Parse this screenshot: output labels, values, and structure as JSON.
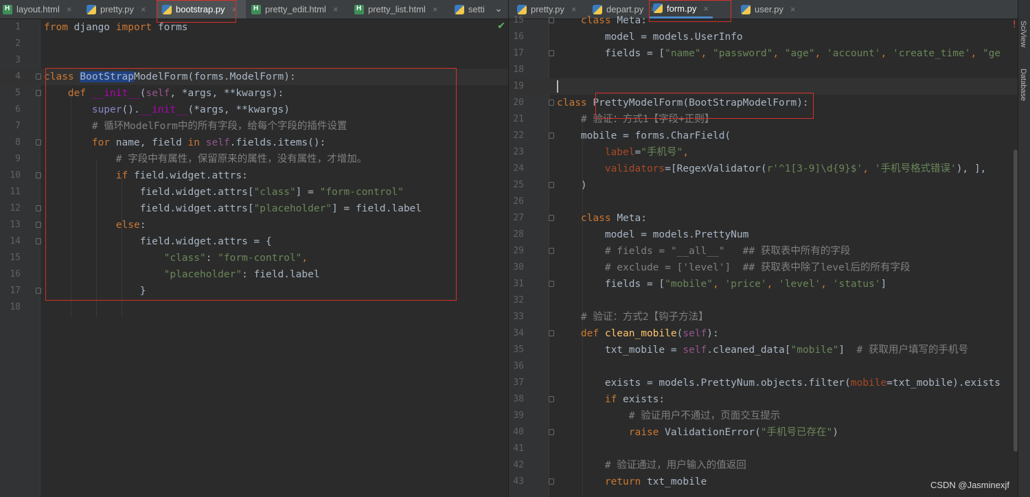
{
  "left_tabs": [
    {
      "label": "layout.html",
      "type": "html"
    },
    {
      "label": "pretty.py",
      "type": "py"
    },
    {
      "label": "bootstrap.py",
      "type": "py",
      "active": true
    },
    {
      "label": "pretty_edit.html",
      "type": "html"
    },
    {
      "label": "pretty_list.html",
      "type": "html"
    },
    {
      "label": "setti",
      "type": "py"
    }
  ],
  "right_tabs": [
    {
      "label": "pretty.py",
      "type": "py"
    },
    {
      "label": "depart.py",
      "type": "py"
    },
    {
      "label": "form.py",
      "type": "py",
      "active": true
    },
    {
      "label": "user.py",
      "type": "py"
    }
  ],
  "left_code": {
    "l1": {
      "kw1": "from",
      "mod": " django ",
      "kw2": "import",
      "name": " forms"
    },
    "l4": {
      "kw": "class ",
      "hl": "BootStrap",
      "cls_rest": "ModelForm",
      "rest": "(forms.ModelForm):"
    },
    "l5": {
      "kw": "def ",
      "fn": "__init__",
      "p1": "(",
      "self": "self",
      "rest": ", *args, **kwargs):"
    },
    "l6": {
      "sup": "super",
      "p": "().",
      "dunder": "__init__",
      "rest": "(*args, **kwargs)"
    },
    "l7": {
      "cmt": "# 循环ModelForm中的所有字段，给每个字段的插件设置"
    },
    "l8": {
      "kw1": "for",
      "mid": " name, field ",
      "kw2": "in",
      "sp": " ",
      "self": "self",
      "rest": ".fields.items():"
    },
    "l9": {
      "cmt": "# 字段中有属性，保留原来的属性，没有属性，才增加。"
    },
    "l10": {
      "kw": "if",
      "rest": " field.widget.attrs:"
    },
    "l11": {
      "a": "field.widget.attrs[",
      "s1": "\"class\"",
      "b": "] = ",
      "s2": "\"form-control\""
    },
    "l12": {
      "a": "field.widget.attrs[",
      "s1": "\"placeholder\"",
      "b": "] = field.label"
    },
    "l13": {
      "kw": "else",
      "rest": ":"
    },
    "l14": {
      "text": "field.widget.attrs = {"
    },
    "l15": {
      "s1": "\"class\"",
      "b": ": ",
      "s2": "\"form-control\"",
      "c": ","
    },
    "l16": {
      "s1": "\"placeholder\"",
      "b": ": field.label"
    },
    "l17": {
      "text": "}"
    }
  },
  "right_code": {
    "l15": {
      "kw": "class ",
      "rest": "Meta:"
    },
    "l16": {
      "text": "model = models.UserInfo"
    },
    "l17": {
      "a": "fields = [",
      "s1": "\"name\"",
      "c1": ", ",
      "s2": "\"password\"",
      "c2": ", ",
      "s3": "\"age\"",
      "c3": ", ",
      "s4": "'account'",
      "c4": ", ",
      "s5": "'create_time'",
      "c5": ", ",
      "s6": "\"ge"
    },
    "l20": {
      "kw": "class ",
      "rest": "PrettyModelForm(BootStrapModelForm):"
    },
    "l21": {
      "cmt": "# 验证：方式1【字段+正则】"
    },
    "l22": {
      "text": "mobile = forms.CharField("
    },
    "l23": {
      "param": "label",
      "eq": "=",
      "s": "\"手机号\"",
      "c": ","
    },
    "l24": {
      "param": "validators",
      "eq": "=[RegexValidator(",
      "s1": "r'^1[3-9]\\d{9}$'",
      "c": ", ",
      "s2": "'手机号格式错误'",
      "end": "), ],"
    },
    "l25": {
      "text": ")"
    },
    "l27": {
      "kw": "class ",
      "rest": "Meta:"
    },
    "l28": {
      "text": "model = models.PrettyNum"
    },
    "l29": {
      "cmt": "# fields = \"__all__\"   ## 获取表中所有的字段"
    },
    "l30": {
      "cmt": "# exclude = ['level']  ## 获取表中除了level后的所有字段"
    },
    "l31": {
      "a": "fields = [",
      "s1": "\"mobile\"",
      "c1": ", ",
      "s2": "'price'",
      "c2": ", ",
      "s3": "'level'",
      "c3": ", ",
      "s4": "'status'",
      "end": "]"
    },
    "l33": {
      "cmt": "# 验证：方式2【钩子方法】"
    },
    "l34": {
      "kw": "def ",
      "fn": "clean_mobile",
      "p": "(",
      "self": "self",
      "end": "):"
    },
    "l35": {
      "a": "txt_mobile = ",
      "self": "self",
      "b": ".cleaned_data[",
      "s": "\"mobile\"",
      "c": "]  ",
      "cmt": "# 获取用户填写的手机号"
    },
    "l37": {
      "a": "exists = models.PrettyNum.objects.filter(",
      "param": "mobile",
      "b": "=txt_mobile).exists"
    },
    "l38": {
      "kw": "if",
      "rest": " exists:"
    },
    "l39": {
      "cmt": "# 验证用户不通过，页面交互提示"
    },
    "l40": {
      "kw": "raise",
      "a": " ValidationError(",
      "s": "\"手机号已存在\"",
      "end": ")"
    },
    "l42": {
      "cmt": "# 验证通过，用户输入的值返回"
    },
    "l43": {
      "kw": "return",
      "rest": " txt_mobile"
    }
  },
  "left_line_numbers": [
    "1",
    "2",
    "3",
    "4",
    "5",
    "6",
    "7",
    "8",
    "9",
    "10",
    "11",
    "12",
    "13",
    "14",
    "15",
    "16",
    "17",
    "18"
  ],
  "right_line_numbers": [
    "15",
    "16",
    "17",
    "18",
    "19",
    "20",
    "21",
    "22",
    "23",
    "24",
    "25",
    "26",
    "27",
    "28",
    "29",
    "30",
    "31",
    "32",
    "33",
    "34",
    "35",
    "36",
    "37",
    "38",
    "39",
    "40",
    "41",
    "42",
    "43"
  ],
  "side_labels": {
    "top": "SciView",
    "bottom": "Database"
  },
  "watermark": "CSDN @Jasminexjf",
  "colors": {
    "background": "#2b2b2b",
    "keyword": "#cc7832",
    "string": "#6a8759",
    "comment": "#808080",
    "function": "#ffc66d",
    "highlight_box": "#d9302c"
  }
}
